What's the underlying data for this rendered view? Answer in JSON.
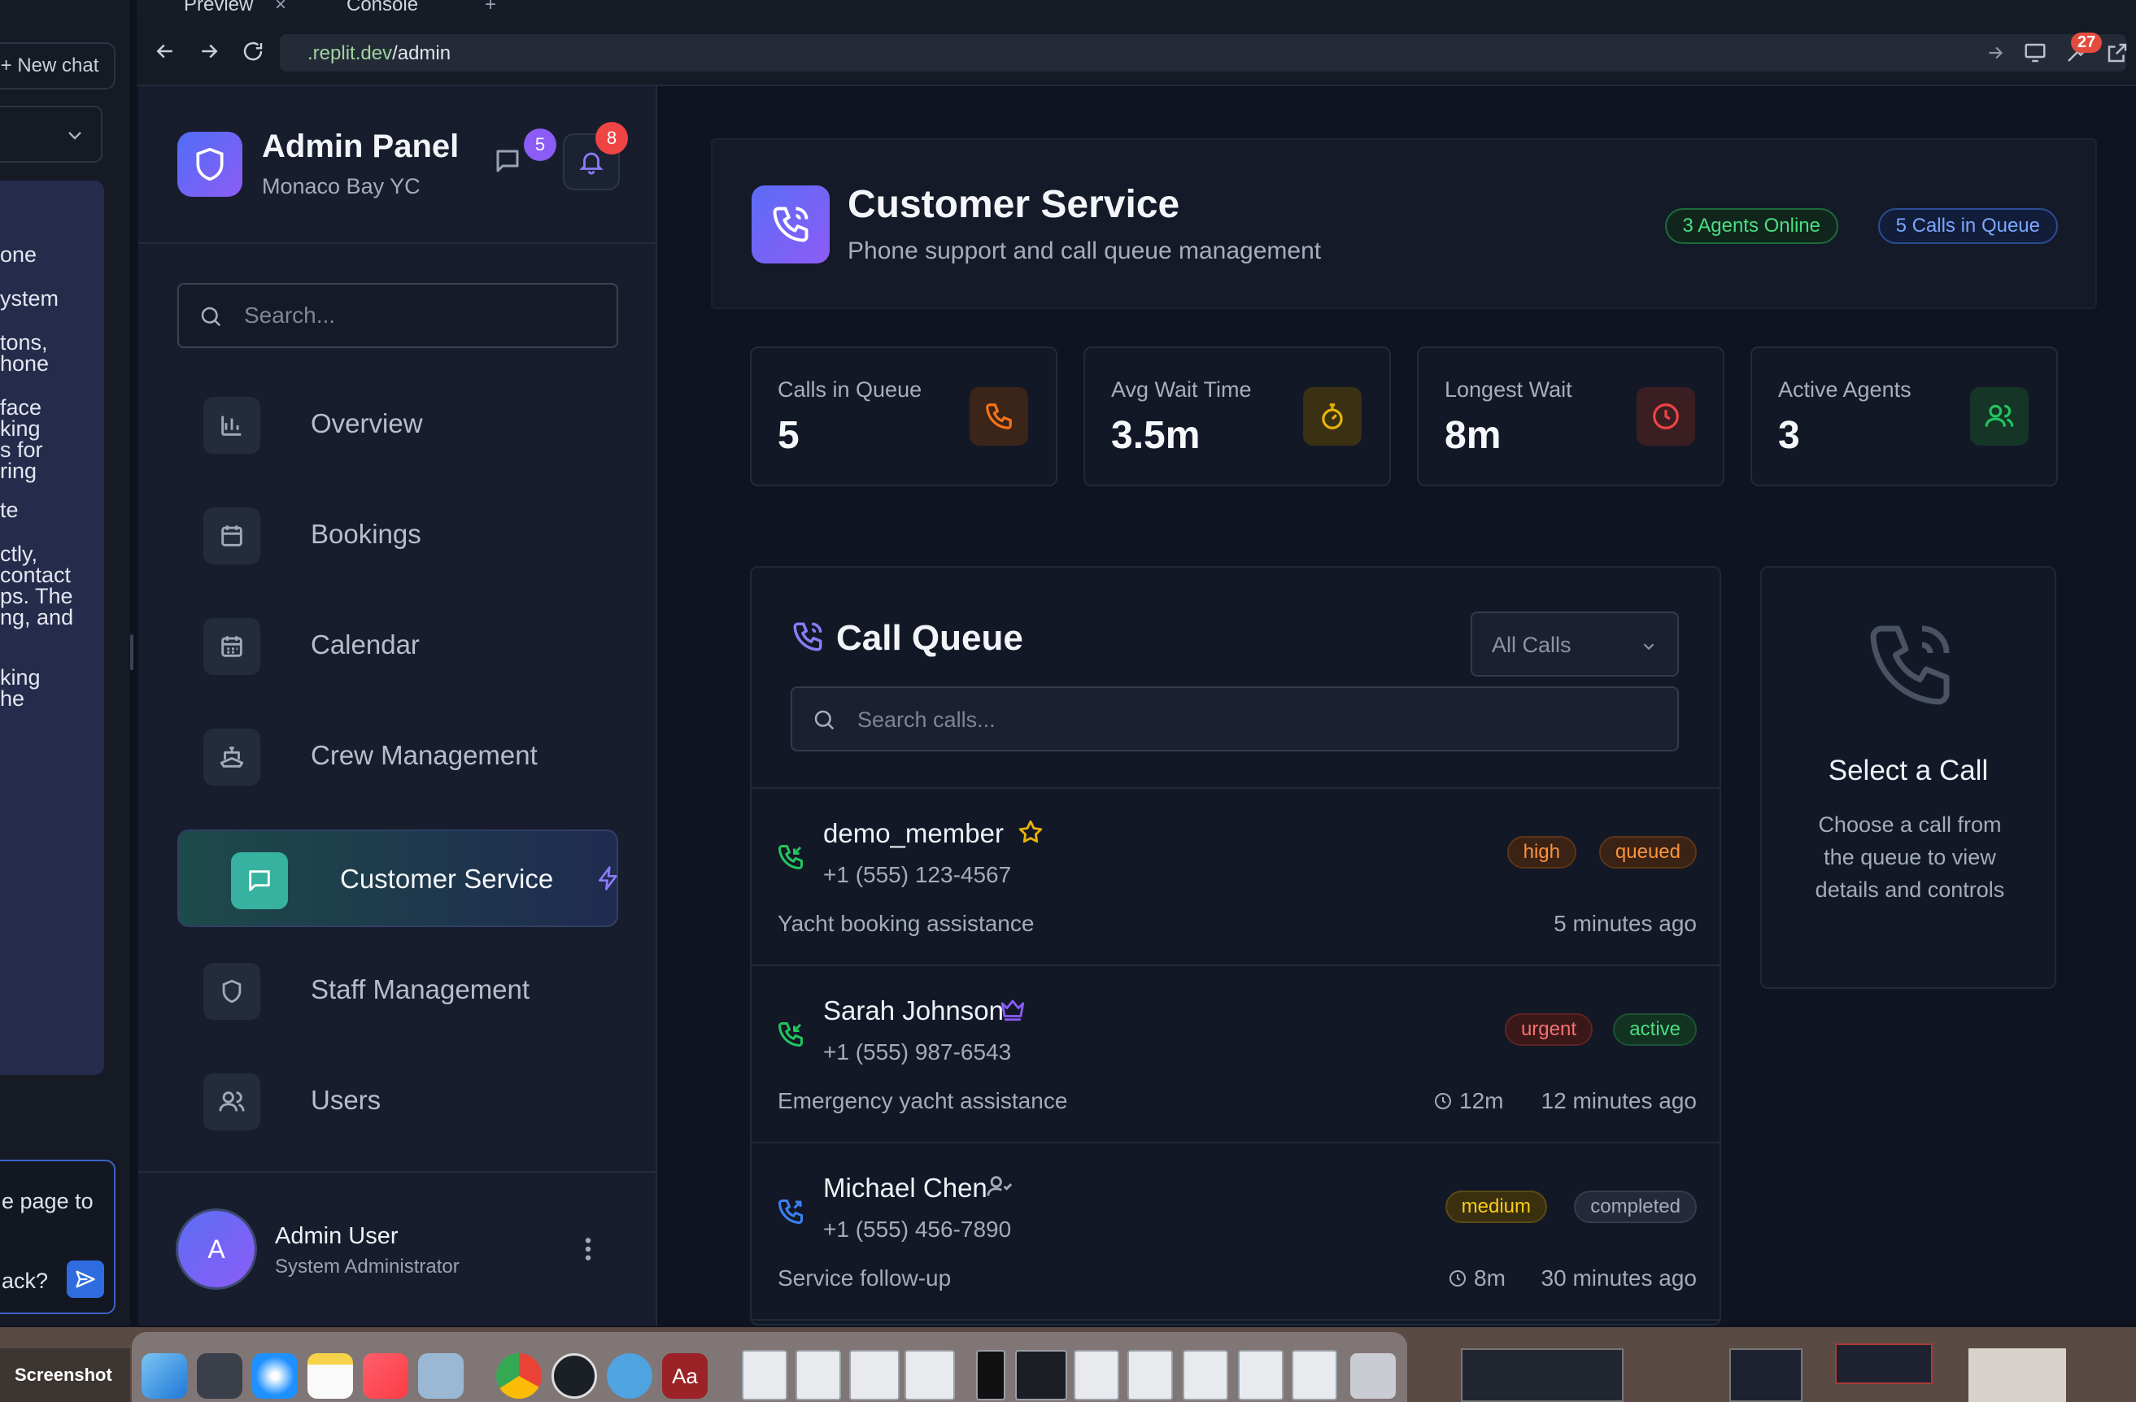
{
  "browser": {
    "tabs": [
      "Preview",
      "Console"
    ],
    "url_domain": ".replit.dev",
    "url_path": "/admin",
    "notification_count": "27"
  },
  "replit_chat": {
    "new_chat_label": "New chat",
    "message_fragments": [
      "one",
      "ystem",
      "tons,",
      "hone",
      "face",
      "king",
      "s for",
      "ring",
      "te",
      "ctly,",
      "contact",
      "ps. The",
      "ng, and",
      "king",
      "he"
    ],
    "input_fragments": [
      "e page to",
      "ack?"
    ]
  },
  "sidebar": {
    "title": "Admin Panel",
    "subtitle": "Monaco Bay YC",
    "message_count": "5",
    "notification_count": "8",
    "search_placeholder": "Search...",
    "items": [
      {
        "label": "Overview",
        "icon": "bar-chart-icon"
      },
      {
        "label": "Bookings",
        "icon": "calendar-icon"
      },
      {
        "label": "Calendar",
        "icon": "calendar-grid-icon"
      },
      {
        "label": "Crew Management",
        "icon": "ship-icon"
      },
      {
        "label": "Customer Service",
        "icon": "message-square-icon",
        "active": true
      },
      {
        "label": "Staff Management",
        "icon": "shield-icon"
      },
      {
        "label": "Users",
        "icon": "users-icon"
      }
    ],
    "user": {
      "initial": "A",
      "name": "Admin User",
      "role": "System Administrator"
    }
  },
  "header": {
    "title": "Customer Service",
    "subtitle": "Phone support and call queue management",
    "agents_online": "3 Agents Online",
    "calls_in_queue": "5 Calls in Queue"
  },
  "stats": [
    {
      "label": "Calls in Queue",
      "value": "5",
      "icon": "phone-icon",
      "color": "#f97316"
    },
    {
      "label": "Avg Wait Time",
      "value": "3.5m",
      "icon": "timer-icon",
      "color": "#eab308"
    },
    {
      "label": "Longest Wait",
      "value": "8m",
      "icon": "clock-icon",
      "color": "#ef4444"
    },
    {
      "label": "Active Agents",
      "value": "3",
      "icon": "users-icon",
      "color": "#22c55e"
    }
  ],
  "queue": {
    "title": "Call Queue",
    "filter_value": "All Calls",
    "search_placeholder": "Search calls...",
    "calls": [
      {
        "name": "demo_member",
        "phone": "+1 (555) 123-4567",
        "reason": "Yacht booking assistance",
        "priority": "high",
        "status": "queued",
        "wait": "",
        "time": "5 minutes ago",
        "badge_icon": "star-icon"
      },
      {
        "name": "Sarah Johnson",
        "phone": "+1 (555) 987-6543",
        "reason": "Emergency yacht assistance",
        "priority": "urgent",
        "status": "active",
        "wait": "12m",
        "time": "12 minutes ago",
        "badge_icon": "crown-icon"
      },
      {
        "name": "Michael Chen",
        "phone": "+1 (555) 456-7890",
        "reason": "Service follow-up",
        "priority": "medium",
        "status": "completed",
        "wait": "8m",
        "time": "30 minutes ago",
        "badge_icon": "user-check-icon"
      }
    ]
  },
  "detail": {
    "title": "Select a Call",
    "body": "Choose a call from the queue to view details and controls"
  },
  "dock": {
    "screenshot_label": "Screenshot"
  }
}
